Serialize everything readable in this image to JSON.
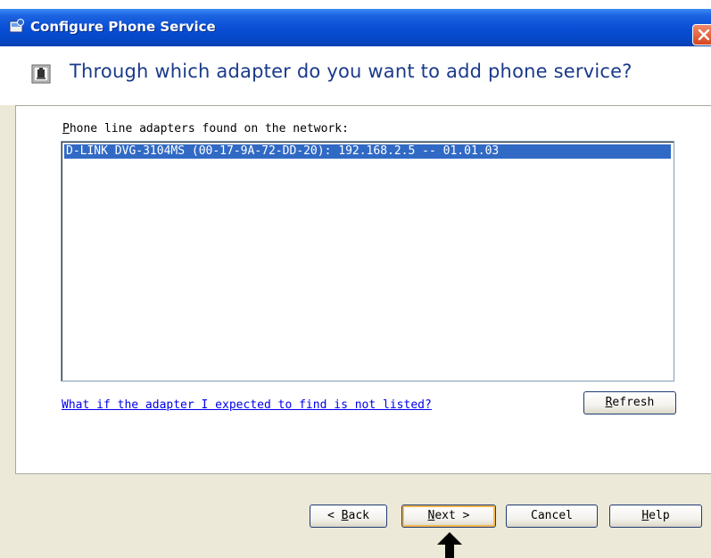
{
  "window": {
    "title": "Configure Phone Service"
  },
  "header": {
    "question": "Through which adapter do you want to add phone service?"
  },
  "adapters": {
    "label_prefix": "P",
    "label_rest": "hone line adapters found on the network:",
    "items": [
      "D-LINK DVG-3104MS  (00-17-9A-72-DD-20):  192.168.2.5 -- 01.01.03"
    ],
    "selected_index": 0
  },
  "help_link": "What if the adapter I expected to find is not listed?",
  "buttons": {
    "refresh": {
      "accel": "R",
      "rest": "efresh"
    },
    "back": {
      "prefix": "< ",
      "accel": "B",
      "rest": "ack"
    },
    "next": {
      "accel": "N",
      "rest": "ext >"
    },
    "cancel": "Cancel",
    "help": {
      "accel": "H",
      "rest": "elp"
    }
  },
  "colors": {
    "titlebar": "#0a4fd6",
    "selection": "#316ac5",
    "dialog_bg": "#ece9d8",
    "header_text": "#1a3a8a"
  },
  "icons": {
    "title": "phone-config-icon",
    "header": "phone-adapter-icon",
    "close": "close-icon",
    "pointer": "arrow-up-icon"
  }
}
